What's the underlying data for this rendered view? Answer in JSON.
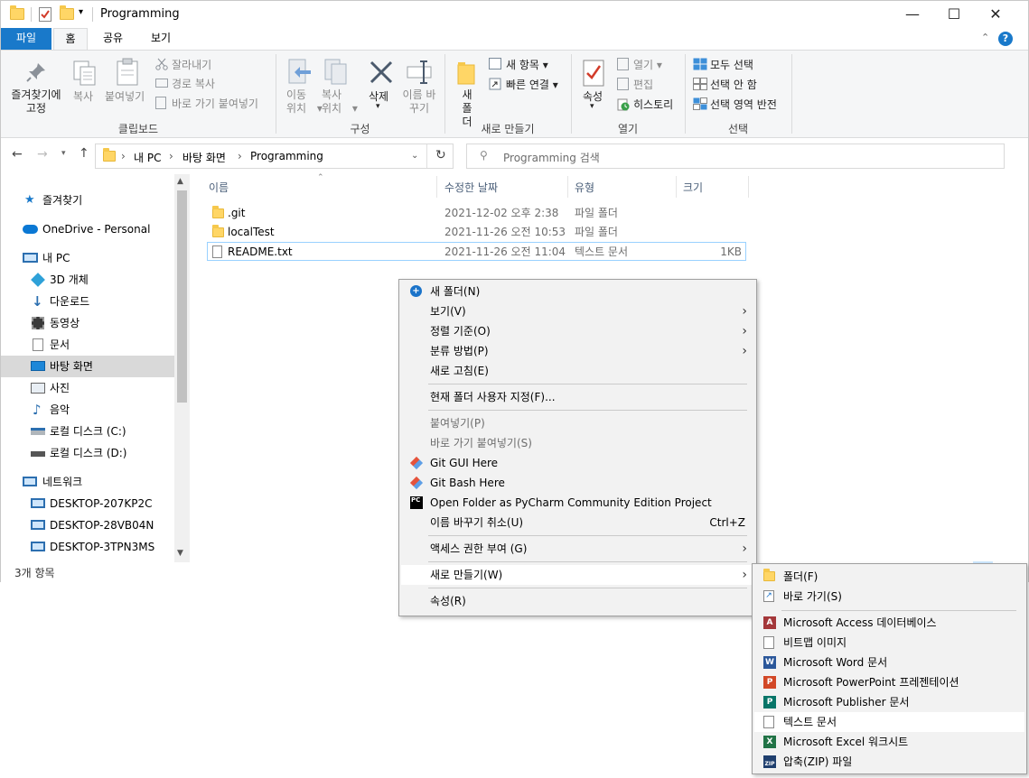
{
  "window": {
    "title": "Programming",
    "qat_dropdown": "▾",
    "controls": {
      "minimize": "—",
      "maximize": "☐",
      "close": "✕"
    }
  },
  "tabs": [
    "파일",
    "홈",
    "공유",
    "보기"
  ],
  "ribbon": {
    "clipboard": {
      "pin": "즐겨찾기에 고정",
      "copy": "복사",
      "paste": "붙여넣기",
      "cut": "잘라내기",
      "copy_path": "경로 복사",
      "paste_shortcut": "바로 가기 붙여넣기",
      "group": "클립보드"
    },
    "organize": {
      "move_to": "이동 위치",
      "copy_to": "복사 위치",
      "delete": "삭제",
      "rename": "이름 바꾸기",
      "group": "구성"
    },
    "new": {
      "new_folder": "새 폴더",
      "new_item": "새 항목",
      "easy_access": "빠른 연결",
      "group": "새로 만들기"
    },
    "open": {
      "properties": "속성",
      "open": "열기",
      "edit": "편집",
      "history": "히스토리",
      "group": "열기"
    },
    "select": {
      "select_all": "모두 선택",
      "select_none": "선택 안 함",
      "invert": "선택 영역 반전",
      "group": "선택"
    }
  },
  "address": {
    "crumbs": [
      "내 PC",
      "바탕 화면",
      "Programming"
    ],
    "search_placeholder": "Programming 검색"
  },
  "nav": {
    "favorites": "즐겨찾기",
    "onedrive": "OneDrive - Personal",
    "this_pc": "내 PC",
    "items": [
      "3D 개체",
      "다운로드",
      "동영상",
      "문서",
      "바탕 화면",
      "사진",
      "음악",
      "로컬 디스크 (C:)",
      "로컬 디스크 (D:)"
    ],
    "network": "네트워크",
    "computers": [
      "DESKTOP-207KP2C",
      "DESKTOP-28VB04N",
      "DESKTOP-3TPN3MS"
    ]
  },
  "columns": {
    "name": "이름",
    "modified": "수정한 날짜",
    "type": "유형",
    "size": "크기"
  },
  "files": [
    {
      "name": ".git",
      "modified": "2021-12-02 오후 2:38",
      "type": "파일 폴더",
      "size": ""
    },
    {
      "name": "localTest",
      "modified": "2021-11-26 오전 10:53",
      "type": "파일 폴더",
      "size": ""
    },
    {
      "name": "README.txt",
      "modified": "2021-11-26 오전 11:04",
      "type": "텍스트 문서",
      "size": "1KB"
    }
  ],
  "status": {
    "count": "3개 항목"
  },
  "context_menu": {
    "new_folder": "새 폴더(N)",
    "view": "보기(V)",
    "sort": "정렬 기준(O)",
    "group": "분류 방법(P)",
    "refresh": "새로 고침(E)",
    "customize": "현재 폴더 사용자 지정(F)...",
    "paste": "붙여넣기(P)",
    "paste_shortcut": "바로 가기 붙여넣기(S)",
    "git_gui": "Git GUI Here",
    "git_bash": "Git Bash Here",
    "pycharm": "Open Folder as PyCharm Community Edition Project",
    "undo_rename": "이름 바꾸기 취소(U)",
    "undo_shortcut": "Ctrl+Z",
    "give_access": "액세스 권한 부여 (G)",
    "new": "새로 만들기(W)",
    "properties": "속성(R)"
  },
  "submenu": {
    "folder": "폴더(F)",
    "shortcut": "바로 가기(S)",
    "access": "Microsoft Access 데이터베이스",
    "bitmap": "비트맵 이미지",
    "word": "Microsoft Word 문서",
    "powerpoint": "Microsoft PowerPoint 프레젠테이션",
    "publisher": "Microsoft Publisher 문서",
    "text": "텍스트 문서",
    "excel": "Microsoft Excel 워크시트",
    "zip": "압축(ZIP) 파일"
  },
  "colors": {
    "accent": "#1979ca",
    "selection": "#cce8ff",
    "folder": "#ffd666"
  }
}
